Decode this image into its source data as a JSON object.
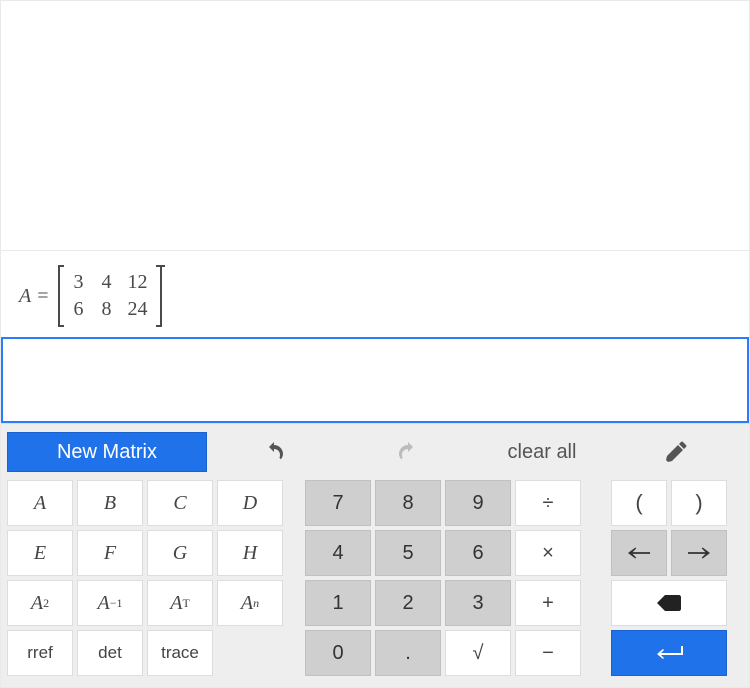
{
  "expression": {
    "var": "A",
    "eq": "=",
    "matrix": [
      [
        "3",
        "4",
        "12"
      ],
      [
        "6",
        "8",
        "24"
      ]
    ]
  },
  "toolbar": {
    "new_matrix": "New Matrix",
    "clear_all": "clear all"
  },
  "vars": {
    "A": "A",
    "B": "B",
    "C": "C",
    "D": "D",
    "E": "E",
    "F": "F",
    "G": "G",
    "H": "H"
  },
  "powers": {
    "sq_base": "A",
    "sq_exp": "2",
    "inv_base": "A",
    "inv_exp": "−1",
    "t_base": "A",
    "t_exp": "T",
    "n_base": "A",
    "n_exp": "n"
  },
  "funcs": {
    "rref": "rref",
    "det": "det",
    "trace": "trace"
  },
  "digits": {
    "d7": "7",
    "d8": "8",
    "d9": "9",
    "d4": "4",
    "d5": "5",
    "d6": "6",
    "d1": "1",
    "d2": "2",
    "d3": "3",
    "d0": "0",
    "dot": "."
  },
  "ops": {
    "div": "÷",
    "mul": "×",
    "add": "+",
    "sub": "−",
    "sqrt": "√"
  },
  "paren": {
    "l": "(",
    "r": ")"
  }
}
